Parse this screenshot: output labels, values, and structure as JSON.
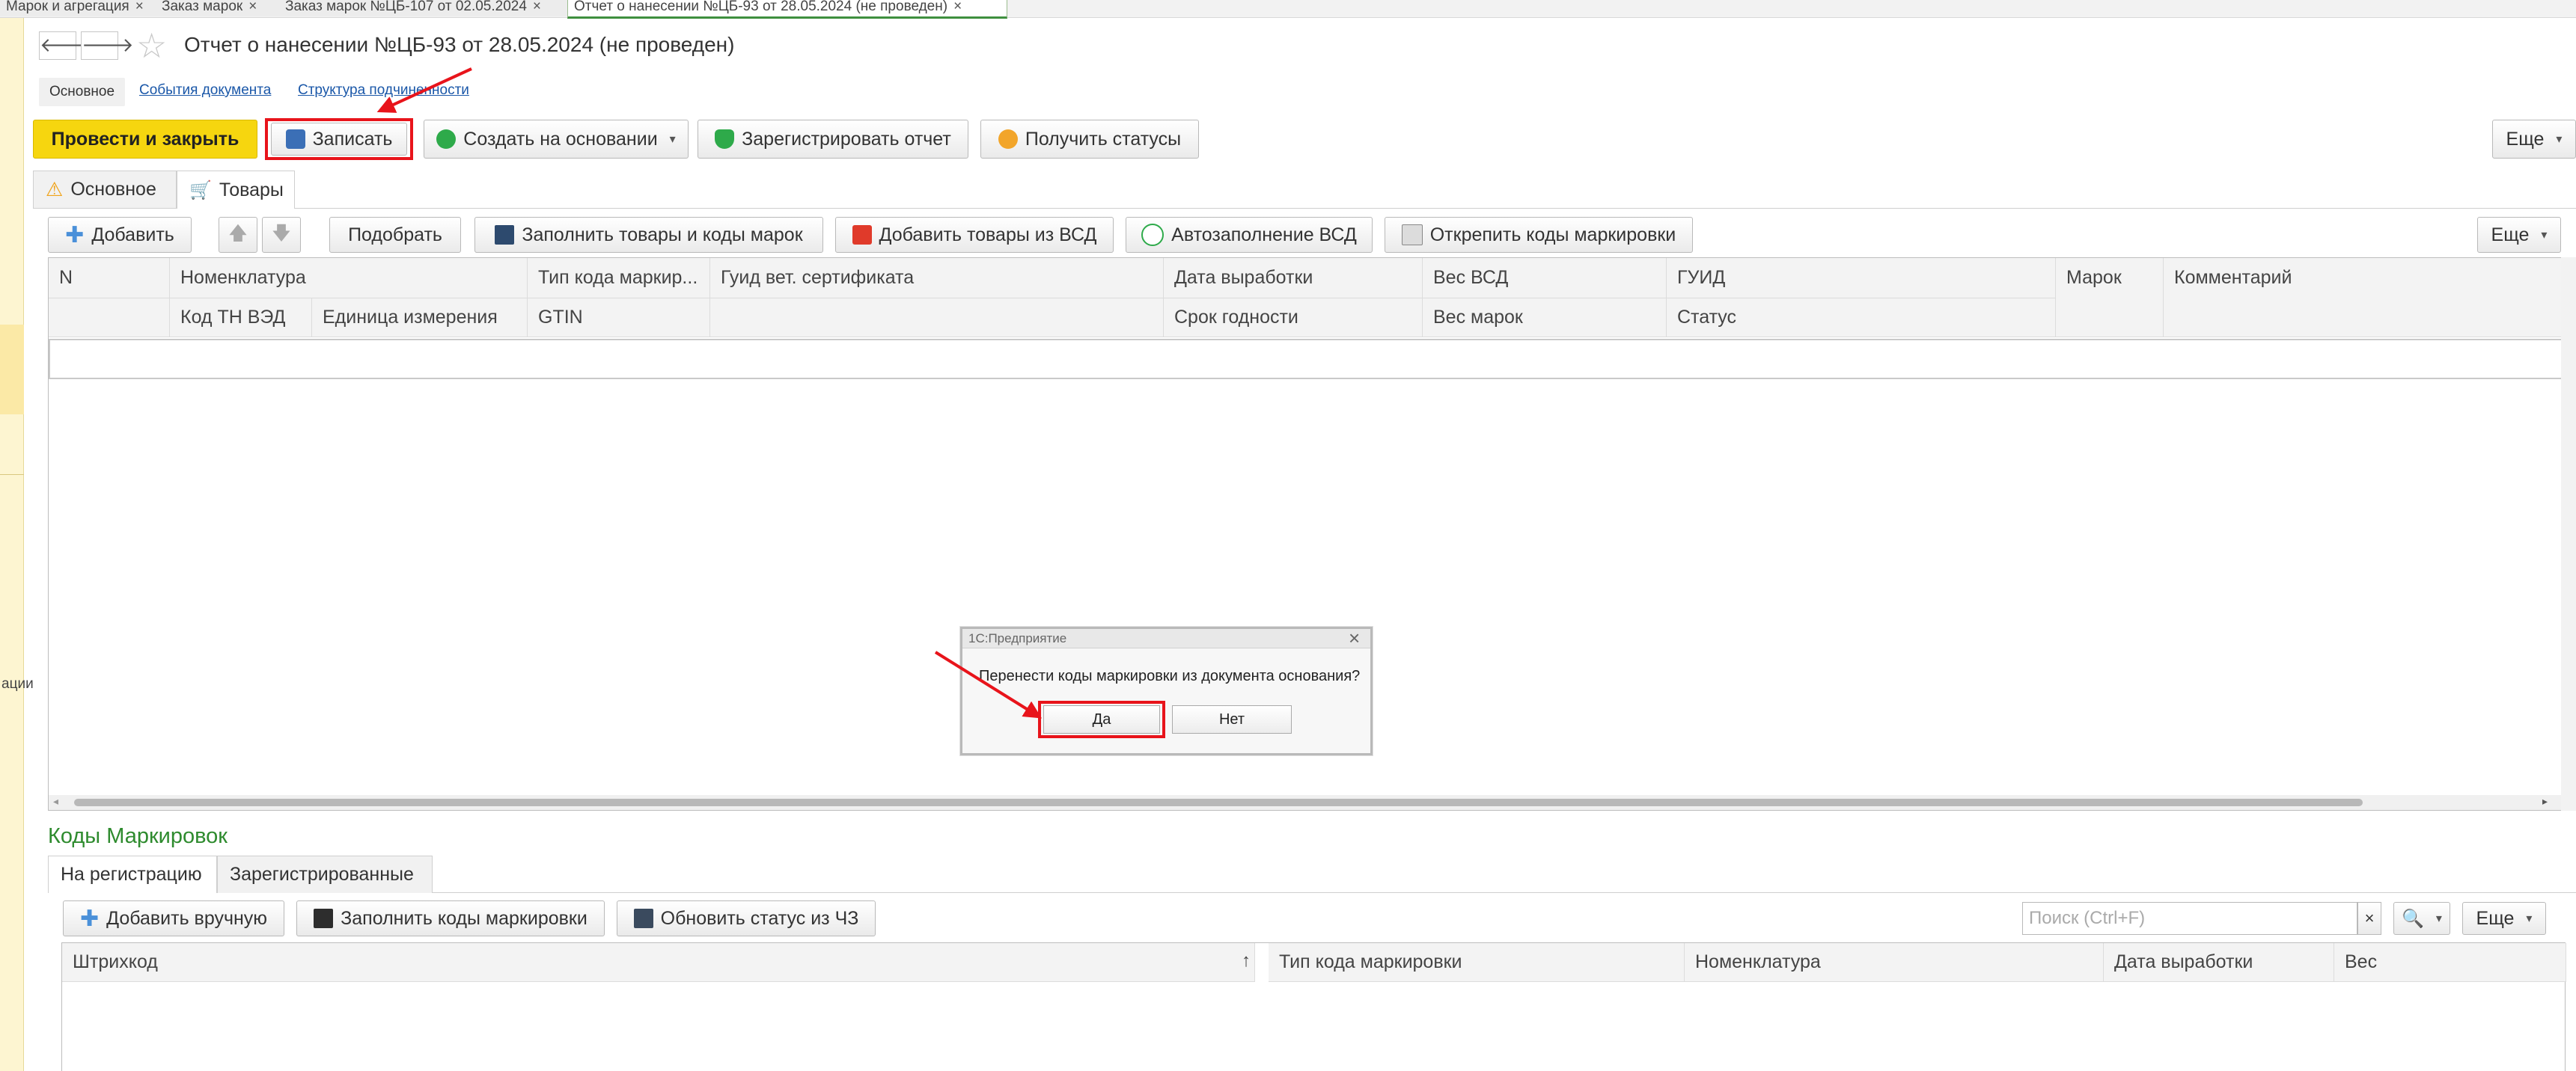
{
  "top_tabs": [
    {
      "label": "Марок и агрегация"
    },
    {
      "label": "Заказ марок"
    },
    {
      "label": "Заказ марок №ЦБ-107 от 02.05.2024"
    },
    {
      "label": "Отчет о нанесении №ЦБ-93 от 28.05.2024 (не проведен)"
    }
  ],
  "left_rail": {
    "text": "ации"
  },
  "header": {
    "back": "🡐",
    "forward": "🡒",
    "star": "☆",
    "title": "Отчет о нанесении №ЦБ-93 от 28.05.2024 (не проведен)",
    "links": {
      "main": "Основное",
      "events": "События документа",
      "structure": "Структура подчиненности"
    }
  },
  "toolbar": {
    "post_close": "Провести и закрыть",
    "save": "Записать",
    "create_based": "Создать на основании",
    "register": "Зарегистрировать отчет",
    "statuses": "Получить статусы",
    "more": "Еще"
  },
  "inner_tabs": {
    "main": "Основное",
    "goods": "Товары"
  },
  "goods_toolbar": {
    "add": "Добавить",
    "pick": "Подобрать",
    "fill_goods": "Заполнить товары и коды марок",
    "add_vsd": "Добавить товары из ВСД",
    "autofill_vsd": "Автозаполнение ВСД",
    "unpin": "Открепить коды маркировки",
    "more": "Еще"
  },
  "goods_table": {
    "row1": [
      "N",
      "Номенклатура",
      "Тип кода маркир...",
      "Гуид вет. сертификата",
      "Дата выработки",
      "Вес ВСД",
      "ГУИД",
      "Марок",
      "Комментарий"
    ],
    "row2": [
      "Код ТН ВЭД",
      "Единица измерения",
      "GTIN",
      "Срок годности",
      "Вес марок",
      "Статус"
    ]
  },
  "codes_section": {
    "title": "Коды Маркировок",
    "tabs": {
      "to_register": "На регистрацию",
      "registered": "Зарегистрированные"
    },
    "toolbar": {
      "add_manual": "Добавить вручную",
      "fill_codes": "Заполнить коды маркировки",
      "refresh_status": "Обновить статус из ЧЗ",
      "search_placeholder": "Поиск (Ctrl+F)",
      "clear": "×",
      "more": "Еще"
    },
    "columns": [
      "Штрихкод",
      "↑",
      "Тип кода маркировки",
      "Номенклатура",
      "Дата выработки",
      "Вес"
    ]
  },
  "dialog": {
    "title": "1С:Предприятие",
    "close": "×",
    "message": "Перенести коды маркировки из документа основания?",
    "yes": "Да",
    "no": "Нет"
  }
}
